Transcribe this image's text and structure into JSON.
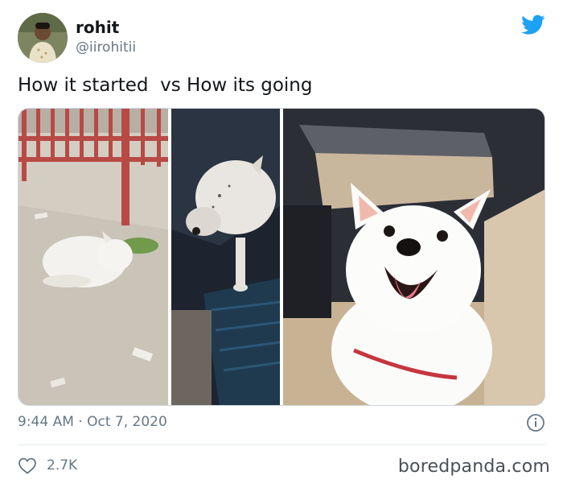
{
  "author": {
    "name": "rohit",
    "handle": "@iirohitii"
  },
  "tweet": {
    "text": "How it started  vs How its going",
    "time": "9:44 AM · Oct 7, 2020",
    "likes": "2.7K"
  },
  "icons": {
    "platform": "twitter-bird-icon",
    "info": "info-icon",
    "like": "heart-icon"
  },
  "watermark": "boredpanda.com",
  "colors": {
    "twitter_blue": "#1da1f2",
    "secondary_text": "#657786",
    "primary_text": "#14171a"
  }
}
